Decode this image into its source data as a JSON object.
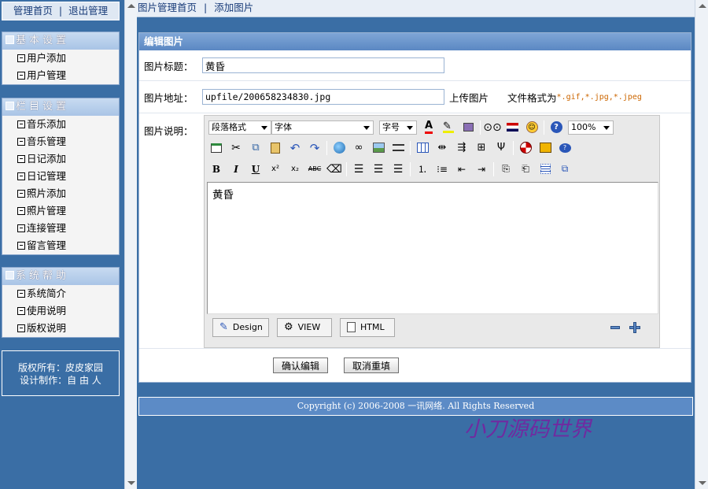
{
  "left_nav": {
    "top_links": {
      "home": "管理首页",
      "sep": "|",
      "logout": "退出管理"
    },
    "groups": [
      {
        "title": "基本设置",
        "items": [
          "用户添加",
          "用户管理"
        ]
      },
      {
        "title": "栏目设置",
        "items": [
          "音乐添加",
          "音乐管理",
          "日记添加",
          "日记管理",
          "照片添加",
          "照片管理",
          "连接管理",
          "留言管理"
        ]
      },
      {
        "title": "系统帮助",
        "items": [
          "系统简介",
          "使用说明",
          "版权说明"
        ]
      }
    ],
    "copyright_line1": "版权所有：皮皮家园",
    "copyright_line2": "设计制作：自 由 人"
  },
  "breadcrumb": {
    "home": "图片管理首页",
    "sep": "|",
    "current": "添加图片"
  },
  "form": {
    "panel_title": "编辑图片",
    "title_label": "图片标题：",
    "title_value": "黄昏",
    "url_label": "图片地址：",
    "url_value": "upfile/200658234830.jpg",
    "upload_label": "上传图片",
    "format_label": "文件格式为",
    "format_values": "*.gif,*.jpg,*.jpeg",
    "desc_label": "图片说明：",
    "confirm_button": "确认编辑",
    "cancel_button": "取消重填"
  },
  "editor": {
    "paragraph_select": "段落格式",
    "font_select": "字体",
    "size_select": "字号",
    "zoom_select": "100%",
    "content": "黄昏",
    "mode_design": "Design",
    "mode_view": "VIEW",
    "mode_html": "HTML"
  },
  "footer": "Copyright (c) 2006-2008 一讯网络. All Rights Reserved",
  "watermark": "小刀源码世界"
}
